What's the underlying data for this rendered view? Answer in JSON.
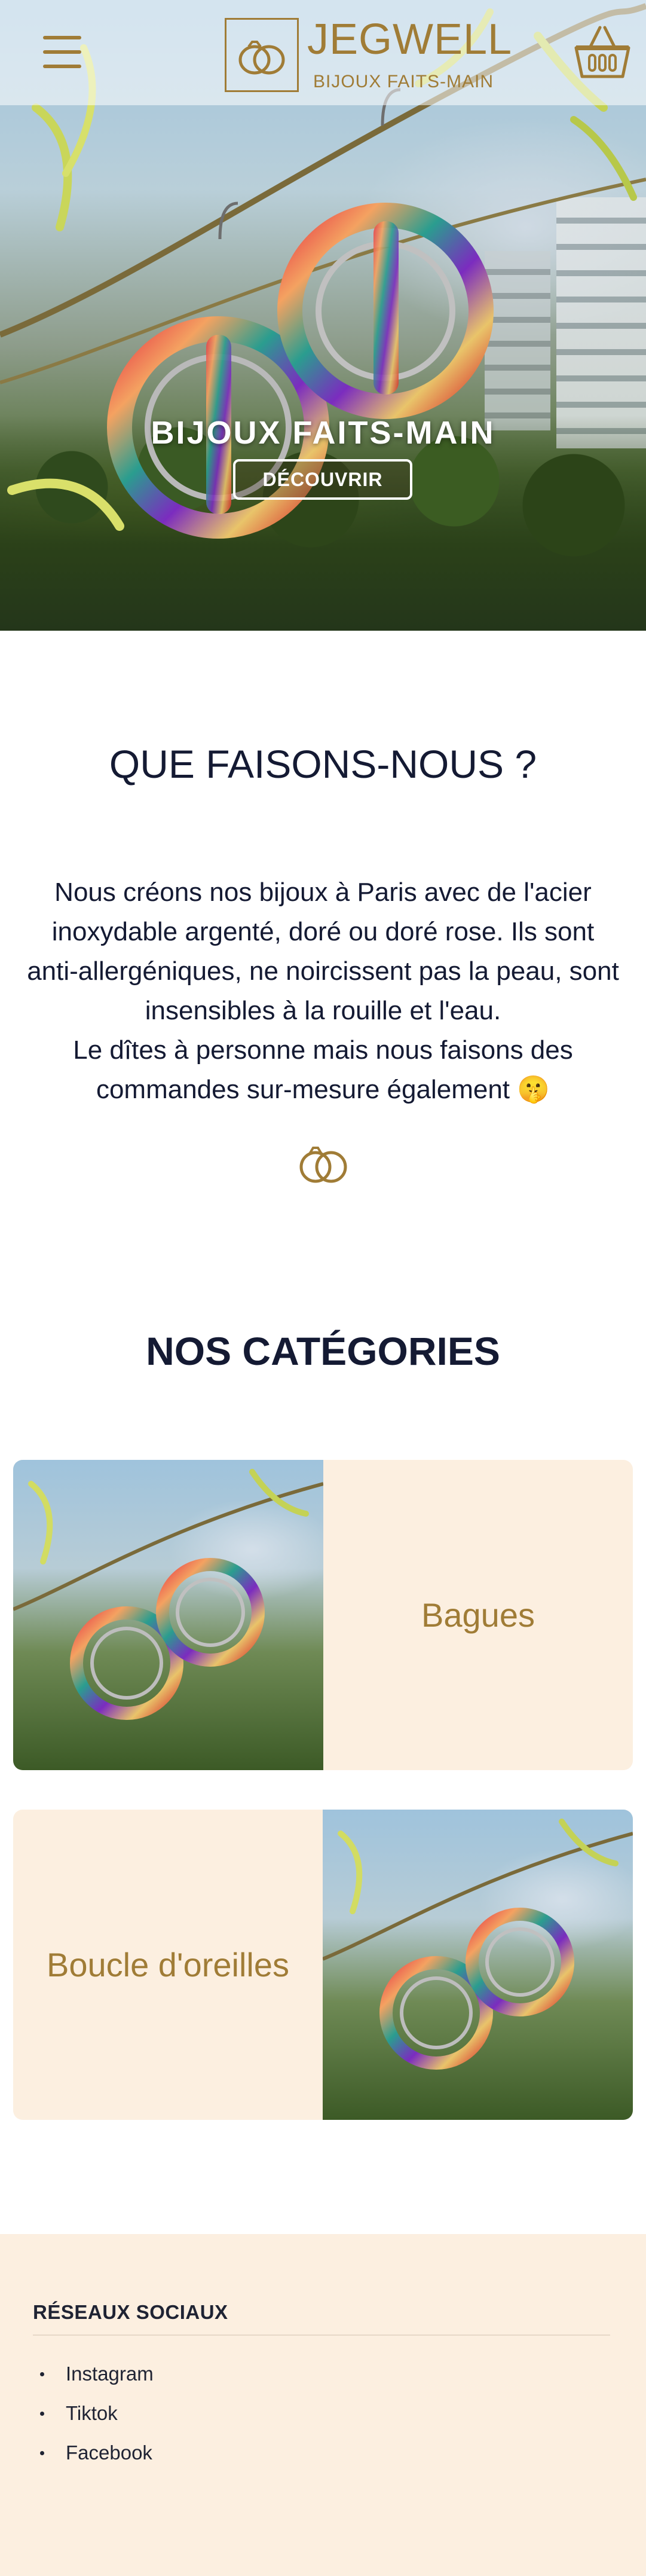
{
  "header": {
    "brand": "JEGWELL",
    "tagline": "BIJOUX FAITS-MAIN",
    "menu_icon": "hamburger-menu-icon",
    "cart_icon": "basket-icon",
    "logo_icon": "rings-icon"
  },
  "hero": {
    "title": "BIJOUX FAITS-MAIN",
    "button_label": "DÉCOUVRIR"
  },
  "about": {
    "title": "QUE FAISONS-NOUS ?",
    "paragraph_1": "Nous créons nos bijoux à Paris avec de l'acier inoxydable argenté, doré ou doré rose. Ils sont anti-allergéniques, ne noircissent pas la peau, sont insensibles à la rouille et l'eau.",
    "paragraph_2": "Le dîtes à personne mais nous faisons des commandes sur-mesure également 🤫",
    "icon": "rings-icon"
  },
  "categories": {
    "title": "NOS CATÉGORIES",
    "items": [
      {
        "label": "Bagues"
      },
      {
        "label": "Boucle d'oreilles"
      }
    ]
  },
  "footer": {
    "heading": "RÉSEAUX SOCIAUX",
    "links": [
      {
        "label": "Instagram"
      },
      {
        "label": "Tiktok"
      },
      {
        "label": "Facebook"
      }
    ]
  },
  "colors": {
    "accent": "#a07c36",
    "cream": "#fcefe0",
    "heading": "#141a33"
  }
}
